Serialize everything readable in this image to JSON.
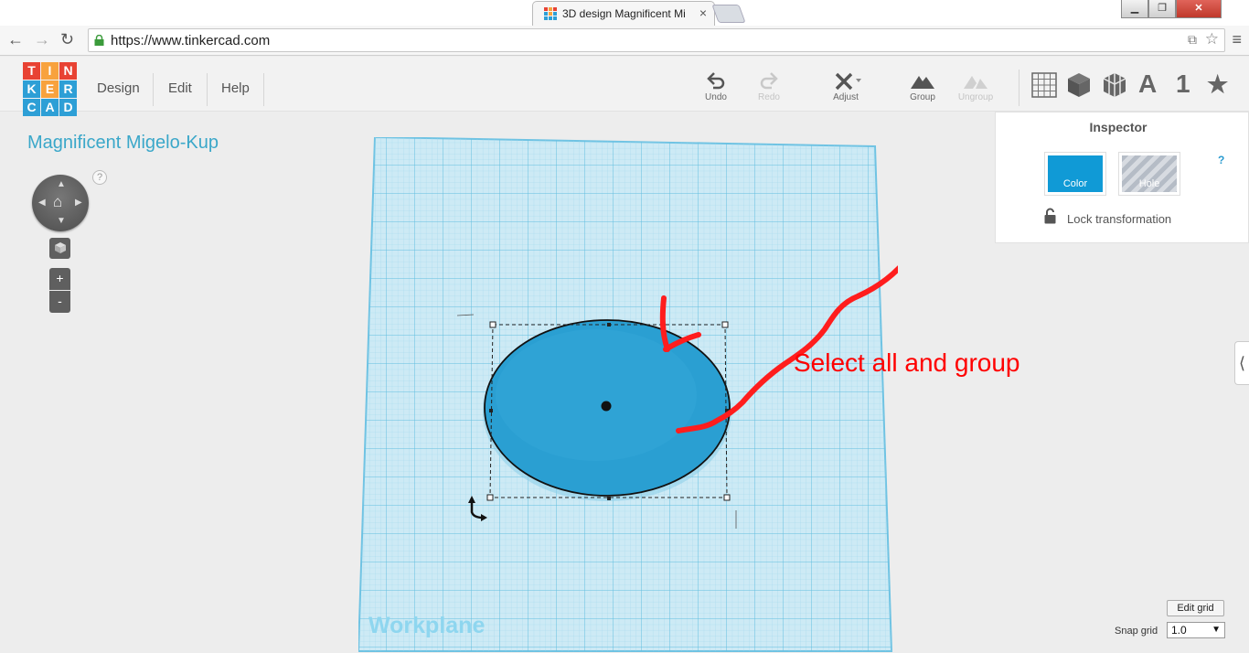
{
  "browser": {
    "tab_title": "3D design Magnificent Mi",
    "tab_close": "×",
    "url": "https://www.tinkercad.com",
    "window_buttons": [
      "▁",
      "❐",
      "✕"
    ]
  },
  "app": {
    "logo_letters": [
      "T",
      "I",
      "N",
      "K",
      "E",
      "R",
      "C",
      "A",
      "D"
    ],
    "logo_colors": [
      "#e84233",
      "#f8a23d",
      "#e84233",
      "#2d9fd6",
      "#f8a23d",
      "#2d9fd6",
      "#2d9fd6",
      "#2d9fd6",
      "#2d9fd6"
    ],
    "menu": [
      "Design",
      "Edit",
      "Help"
    ],
    "toolbar": {
      "undo": "Undo",
      "redo": "Redo",
      "adjust": "Adjust",
      "group": "Group",
      "ungroup": "Ungroup"
    },
    "view_tools": {
      "text_icon": "A",
      "number_icon": "1",
      "star_icon": "★"
    },
    "design_title": "Magnificent Migelo-Kup",
    "help_mark": "?",
    "zoom_in": "+",
    "zoom_out": "-",
    "workplane_label": "Workplane",
    "annotation": "Select all and group",
    "inspector": {
      "title": "Inspector",
      "color_label": "Color",
      "hole_label": "Hole",
      "help": "?",
      "lock_label": "Lock transformation"
    },
    "side_tab": "⟨",
    "edit_grid": "Edit grid",
    "snap_grid_label": "Snap grid",
    "snap_grid_value": "1.0"
  },
  "colors": {
    "accent": "#3aa7c9",
    "shape_fill": "#2a9fd2",
    "workplane": "#cdeaf5",
    "annotation_red": "#ff0000"
  }
}
